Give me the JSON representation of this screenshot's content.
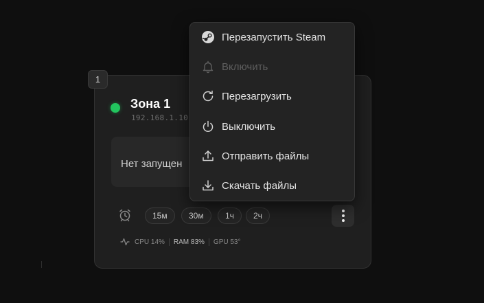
{
  "zone": {
    "number": "1",
    "title": "Зона 1",
    "ip": "192.168.1.10",
    "status_color": "#22c55e",
    "session_text": "Нет запущен"
  },
  "timers": [
    "15м",
    "30м",
    "1ч",
    "2ч"
  ],
  "stats": {
    "cpu": "CPU 14%",
    "ram": "RAM 83%",
    "gpu": "GPU 53°"
  },
  "menu": {
    "items": [
      {
        "label": "Перезапустить Steam",
        "icon": "steam-icon",
        "enabled": true
      },
      {
        "label": "Включить",
        "icon": "bell-icon",
        "enabled": false
      },
      {
        "label": "Перезагрузить",
        "icon": "refresh-icon",
        "enabled": true
      },
      {
        "label": "Выключить",
        "icon": "power-icon",
        "enabled": true
      },
      {
        "label": "Отправить файлы",
        "icon": "upload-icon",
        "enabled": true
      },
      {
        "label": "Скачать файлы",
        "icon": "download-icon",
        "enabled": true
      }
    ]
  }
}
